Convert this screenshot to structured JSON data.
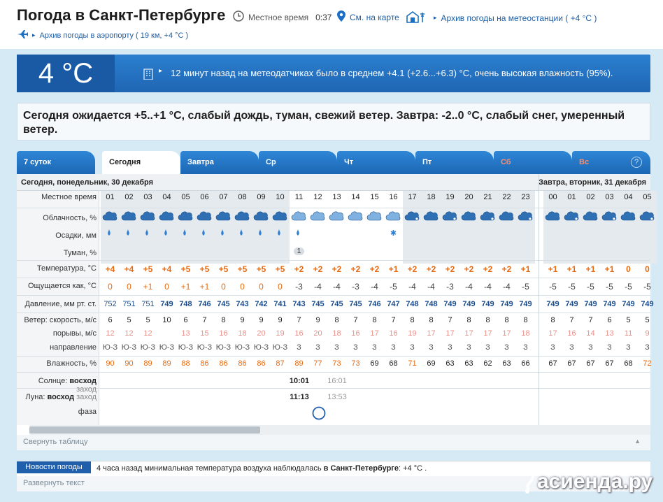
{
  "header": {
    "title": "Погода в Санкт-Петербурге",
    "local_time_label": "Местное время",
    "local_time": "0:37",
    "map_link": "См. на карте",
    "station_archive": "Архив погоды на метеостанции ( +4 °C )",
    "airport_archive": "Архив погоды в аэропорту ( 19 км, +4 °C )"
  },
  "current": {
    "temp": "4 °C",
    "sensor_text": "12 минут назад на метеодатчиках было в среднем +4.1 (+2.6...+6.3) °C, очень высокая влажность (95%)."
  },
  "forecast_text": "Сегодня ожидается +5..+1 °C, слабый дождь, туман, свежий ветер. Завтра: -2..0 °C, слабый снег, умеренный ветер.",
  "tabs": [
    {
      "label": "7 суток"
    },
    {
      "label": "Сегодня"
    },
    {
      "label": "Завтра"
    },
    {
      "label": "Ср"
    },
    {
      "label": "Чт"
    },
    {
      "label": "Пт"
    },
    {
      "label": "Сб"
    },
    {
      "label": "Вс"
    }
  ],
  "help_label": "?",
  "table": {
    "day1": "Сегодня, понедельник, 30 декабря",
    "day2": "Завтра, вторник, 31 декабря",
    "labels": {
      "time": "Местное время",
      "clouds": "Облачность, %",
      "precip": "Осадки, мм",
      "fog": "Туман, %",
      "temp": "Температура, °C",
      "feels": "Ощущается как, °C",
      "pressure": "Давление, мм рт. ст.",
      "wind_speed": "Ветер: скорость, м/с",
      "gusts": "порывы, м/с",
      "direction": "направление",
      "humidity": "Влажность, %",
      "sun_prefix": "Солнце:",
      "sunrise": "восход",
      "sunset": "заход",
      "moon_prefix": "Луна:",
      "moonrise": "восход",
      "moonset": "заход",
      "phase": "фаза"
    },
    "hours": [
      "01",
      "02",
      "03",
      "04",
      "05",
      "06",
      "07",
      "08",
      "09",
      "10",
      "11",
      "12",
      "13",
      "14",
      "15",
      "16",
      "17",
      "18",
      "19",
      "20",
      "21",
      "22",
      "23",
      "00",
      "01",
      "02",
      "03",
      "04",
      "05"
    ],
    "fog_value": "1",
    "temp": [
      "+4",
      "+4",
      "+5",
      "+4",
      "+5",
      "+5",
      "+5",
      "+5",
      "+5",
      "+5",
      "+2",
      "+2",
      "+2",
      "+2",
      "+2",
      "+1",
      "+2",
      "+2",
      "+2",
      "+2",
      "+2",
      "+2",
      "+1",
      "+1",
      "+1",
      "+1",
      "+1",
      "0",
      "0"
    ],
    "feels": [
      "0",
      "0",
      "+1",
      "0",
      "+1",
      "+1",
      "0",
      "0",
      "0",
      "0",
      "-3",
      "-4",
      "-4",
      "-3",
      "-4",
      "-5",
      "-4",
      "-4",
      "-3",
      "-4",
      "-4",
      "-4",
      "-5",
      "-5",
      "-5",
      "-5",
      "-5",
      "-5",
      "-5"
    ],
    "pressure": [
      "752",
      "751",
      "751",
      "749",
      "748",
      "746",
      "745",
      "743",
      "742",
      "741",
      "743",
      "745",
      "745",
      "745",
      "746",
      "747",
      "748",
      "748",
      "749",
      "749",
      "749",
      "749",
      "749",
      "749",
      "749",
      "749",
      "749",
      "749",
      "749"
    ],
    "wind": [
      "6",
      "5",
      "5",
      "10",
      "6",
      "7",
      "8",
      "9",
      "9",
      "9",
      "7",
      "9",
      "8",
      "7",
      "8",
      "7",
      "8",
      "8",
      "7",
      "8",
      "8",
      "8",
      "8",
      "8",
      "7",
      "7",
      "6",
      "5",
      "5"
    ],
    "gusts": [
      "12",
      "12",
      "12",
      "",
      "13",
      "15",
      "16",
      "18",
      "20",
      "19",
      "16",
      "20",
      "18",
      "16",
      "17",
      "16",
      "19",
      "17",
      "17",
      "17",
      "17",
      "17",
      "18",
      "17",
      "16",
      "14",
      "13",
      "11",
      "9"
    ],
    "direction": [
      "Ю-З",
      "Ю-З",
      "Ю-З",
      "Ю-З",
      "Ю-З",
      "Ю-З",
      "Ю-З",
      "Ю-З",
      "Ю-З",
      "Ю-З",
      "З",
      "З",
      "З",
      "З",
      "З",
      "З",
      "З",
      "З",
      "З",
      "З",
      "З",
      "З",
      "З",
      "З",
      "З",
      "З",
      "З",
      "З",
      "З"
    ],
    "humidity": [
      "90",
      "90",
      "89",
      "89",
      "88",
      "86",
      "86",
      "86",
      "86",
      "87",
      "89",
      "77",
      "73",
      "73",
      "69",
      "68",
      "71",
      "69",
      "63",
      "63",
      "62",
      "63",
      "66",
      "67",
      "67",
      "67",
      "67",
      "68",
      "72"
    ],
    "sunrise": "10:01",
    "sunset": "16:01",
    "moonrise": "11:13",
    "moonset": "13:53",
    "collapse": "Свернуть таблицу"
  },
  "news": {
    "badge": "Новости погоды",
    "text_pre": "4 часа назад минимальная температура воздуха наблюдалась",
    "text_bold": "в Санкт-Петербурге",
    "text_post": ": +4 °C .",
    "expand": "Развернуть текст"
  },
  "watermark": "асиенда.ру",
  "colors": {
    "accent": "#1f66b3",
    "temp_orange": "#e86a10",
    "wind_red": "#d94a2a",
    "gust_pink": "#e8908a",
    "pressure_blue": "#1a4d8f"
  }
}
